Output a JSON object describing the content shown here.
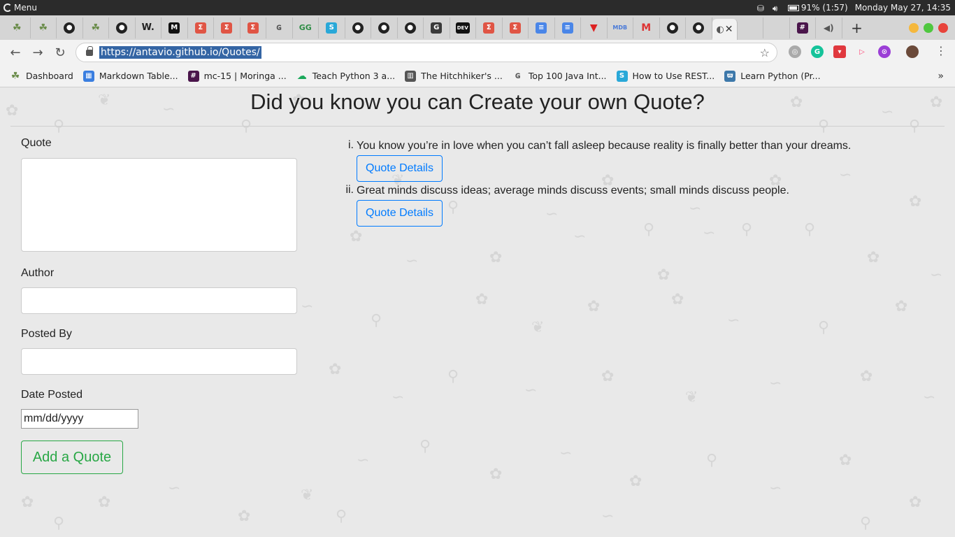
{
  "os_panel": {
    "menu_label": "Menu",
    "battery": "91% (1:57)",
    "datetime": "Monday May 27, 14:35"
  },
  "tabs": [
    {
      "icon": "palm-tree-icon"
    },
    {
      "icon": "palm-tree-icon"
    },
    {
      "icon": "github-icon"
    },
    {
      "icon": "palm-tree-icon"
    },
    {
      "icon": "github-icon"
    },
    {
      "icon": "w-icon"
    },
    {
      "icon": "medium-icon"
    },
    {
      "icon": "sigma-icon"
    },
    {
      "icon": "sigma-icon"
    },
    {
      "icon": "sigma-icon"
    },
    {
      "icon": "goodreads-icon"
    },
    {
      "icon": "geeksforgeeks-icon"
    },
    {
      "icon": "s-icon"
    },
    {
      "icon": "github-icon"
    },
    {
      "icon": "github-icon"
    },
    {
      "icon": "github-icon"
    },
    {
      "icon": "g-icon"
    },
    {
      "icon": "dev-icon"
    },
    {
      "icon": "sigma-icon"
    },
    {
      "icon": "sigma-icon"
    },
    {
      "icon": "docs-icon"
    },
    {
      "icon": "docs-icon"
    },
    {
      "icon": "triangle-icon"
    },
    {
      "icon": "mdb-icon"
    },
    {
      "icon": "gmail-icon"
    },
    {
      "icon": "github-icon"
    },
    {
      "icon": "github-icon"
    }
  ],
  "tab_labels": {
    "w": "W.",
    "m": "M",
    "s": "S",
    "g": "G",
    "dev": "DEV",
    "mdb": "MDB",
    "gfg": "GG"
  },
  "address_bar": {
    "url": "https://antavio.github.io/Quotes/"
  },
  "bookmarks": [
    {
      "label": "Dashboard",
      "icon": "palm-tree-icon"
    },
    {
      "label": "Markdown Table...",
      "icon": "table-icon"
    },
    {
      "label": "mc-15 | Moringa ...",
      "icon": "slack-icon"
    },
    {
      "label": "Teach Python 3 a...",
      "icon": "codecademy-icon"
    },
    {
      "label": "The Hitchhiker's ...",
      "icon": "book-icon"
    },
    {
      "label": "Top 100 Java Int...",
      "icon": "goodreads-icon"
    },
    {
      "label": "How to Use REST...",
      "icon": "s-icon"
    },
    {
      "label": "Learn Python (Pr...",
      "icon": "python-icon"
    }
  ],
  "page": {
    "title": "Did you know you can Create your own Quote?",
    "form": {
      "quote_label": "Quote",
      "author_label": "Author",
      "posted_by_label": "Posted By",
      "date_label": "Date Posted",
      "date_placeholder": "mm/dd/yyyy",
      "submit_label": "Add a Quote"
    },
    "quotes": [
      {
        "num": "i.",
        "text": "You know you’re in love when you can’t fall asleep because reality is finally better than your dreams.",
        "button": "Quote Details"
      },
      {
        "num": "ii.",
        "text": "Great minds discuss ideas; average minds discuss events; small minds discuss people.",
        "button": "Quote Details"
      }
    ]
  },
  "colors": {
    "success": "#28a745",
    "primary": "#007bff",
    "page_bg": "#e9e9e9"
  }
}
